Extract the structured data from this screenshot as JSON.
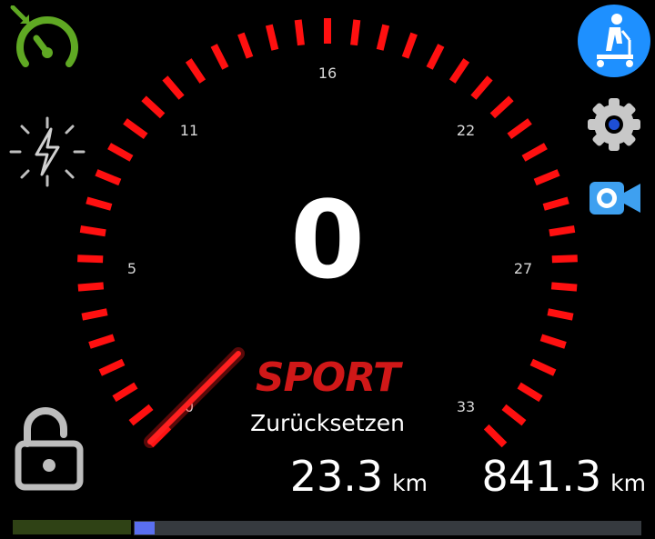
{
  "speed": {
    "value": "0",
    "mode": "SPORT",
    "reset_label": "Zurücksetzen"
  },
  "gauge": {
    "tick_labels": [
      "0",
      "5",
      "11",
      "16",
      "22",
      "27",
      "33"
    ],
    "needle_color": "#ff1a1a",
    "tick_color": "#ff1010"
  },
  "trip": {
    "value": "23.3",
    "unit": "km"
  },
  "odometer": {
    "value": "841.3",
    "unit": "km"
  },
  "progress": {
    "fraction": 0.04,
    "fill_color": "#5a6ff0"
  },
  "icons": {
    "top_left": "cruise-control-icon",
    "left_middle": "power-boost-icon",
    "lock": "unlocked-padlock-icon",
    "scooter": "scooter-rider-icon",
    "settings": "gear-icon",
    "camera": "video-camera-icon"
  },
  "colors": {
    "accent_green": "#5fa823",
    "accent_blue": "#1e90ff",
    "mode_red": "#d01818"
  }
}
